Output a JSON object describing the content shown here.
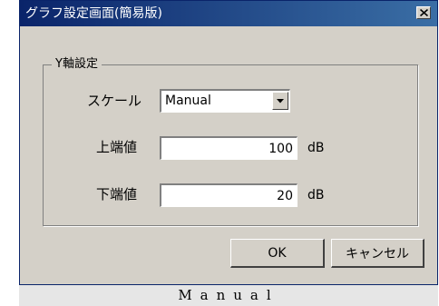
{
  "window": {
    "title": "グラフ設定画面(簡易版)",
    "close_icon": "close-icon"
  },
  "y_axis_group": {
    "legend": "Y軸設定",
    "scale": {
      "label": "スケール",
      "selected": "Manual",
      "dropdown_icon": "chevron-down-icon"
    },
    "upper": {
      "label": "上端値",
      "value": "100",
      "unit": "dB"
    },
    "lower": {
      "label": "下端値",
      "value": "20",
      "unit": "dB"
    }
  },
  "buttons": {
    "ok": "OK",
    "cancel": "キャンセル"
  },
  "caption": "Manual",
  "colors": {
    "title_bar_start": "#0a246a",
    "title_bar_end": "#3a6ea5",
    "dialog_face": "#d4d0c8"
  }
}
